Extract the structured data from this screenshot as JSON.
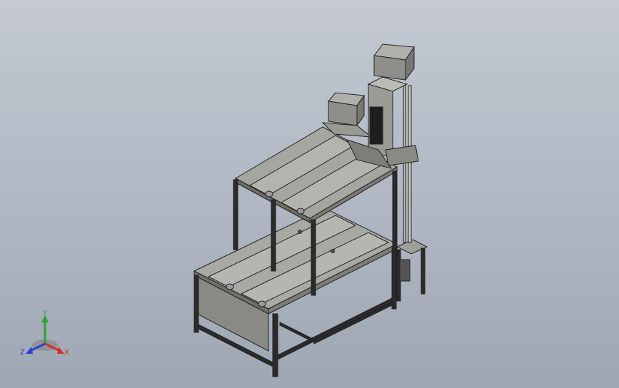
{
  "viewport": {
    "background_top": "#c4c9d2",
    "background_bottom": "#9fa7b3"
  },
  "model": {
    "description_icon": "conveyor-assembly-isometric",
    "frame_color": "#2b2b2b",
    "panel_color": "#8c8c86",
    "belt_color": "#9a9a94",
    "motor_color": "#8e8e8a"
  },
  "triad": {
    "labels": {
      "x": "X",
      "y": "Y",
      "z": "Z"
    },
    "colors": {
      "x": "#d03030",
      "y": "#2fa02f",
      "z": "#2f3fd0"
    }
  }
}
